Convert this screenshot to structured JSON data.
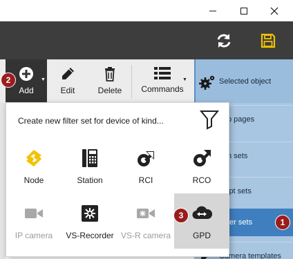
{
  "window": {
    "controls": [
      {
        "name": "minimize",
        "icon": "minimize-icon"
      },
      {
        "name": "maximize",
        "icon": "maximize-icon"
      },
      {
        "name": "close",
        "icon": "close-icon"
      }
    ]
  },
  "header": {
    "icons": [
      "refresh-icon",
      "save-icon"
    ],
    "save_color": "#f2c200"
  },
  "toolbar": {
    "add_label": "Add",
    "edit_label": "Edit",
    "delete_label": "Delete",
    "commands_label": "Commands"
  },
  "right_panel": {
    "items": [
      {
        "label": "Selected object",
        "icon": "gear-icon"
      },
      {
        "label": "p pages"
      },
      {
        "label": "n sets"
      },
      {
        "label": "ipt sets"
      },
      {
        "label": "ter sets",
        "active": true
      },
      {
        "label": "Camera templates",
        "icon": "pencil-icon"
      }
    ]
  },
  "popup": {
    "title": "Create new filter set for device of kind...",
    "filter_icon": "funnel-icon",
    "tiles": [
      {
        "label": "Node",
        "icon": "node-icon",
        "enabled": true
      },
      {
        "label": "Station",
        "icon": "station-icon",
        "enabled": true
      },
      {
        "label": "RCI",
        "icon": "rci-icon",
        "enabled": true
      },
      {
        "label": "RCO",
        "icon": "rco-icon",
        "enabled": true
      },
      {
        "label": "IP camera",
        "icon": "ip-camera-icon",
        "enabled": false
      },
      {
        "label": "VS-Recorder",
        "icon": "vs-recorder-icon",
        "enabled": true
      },
      {
        "label": "VS-R camera",
        "icon": "vs-r-camera-icon",
        "enabled": false
      },
      {
        "label": "GPD",
        "icon": "gpd-icon",
        "enabled": true,
        "selected": true
      }
    ]
  },
  "badges": [
    "1",
    "2",
    "3"
  ],
  "colors": {
    "accent": "#3f7fbf",
    "badge": "#9b1c1c",
    "node_icon": "#f2c200",
    "header": "#3d3d3d"
  }
}
